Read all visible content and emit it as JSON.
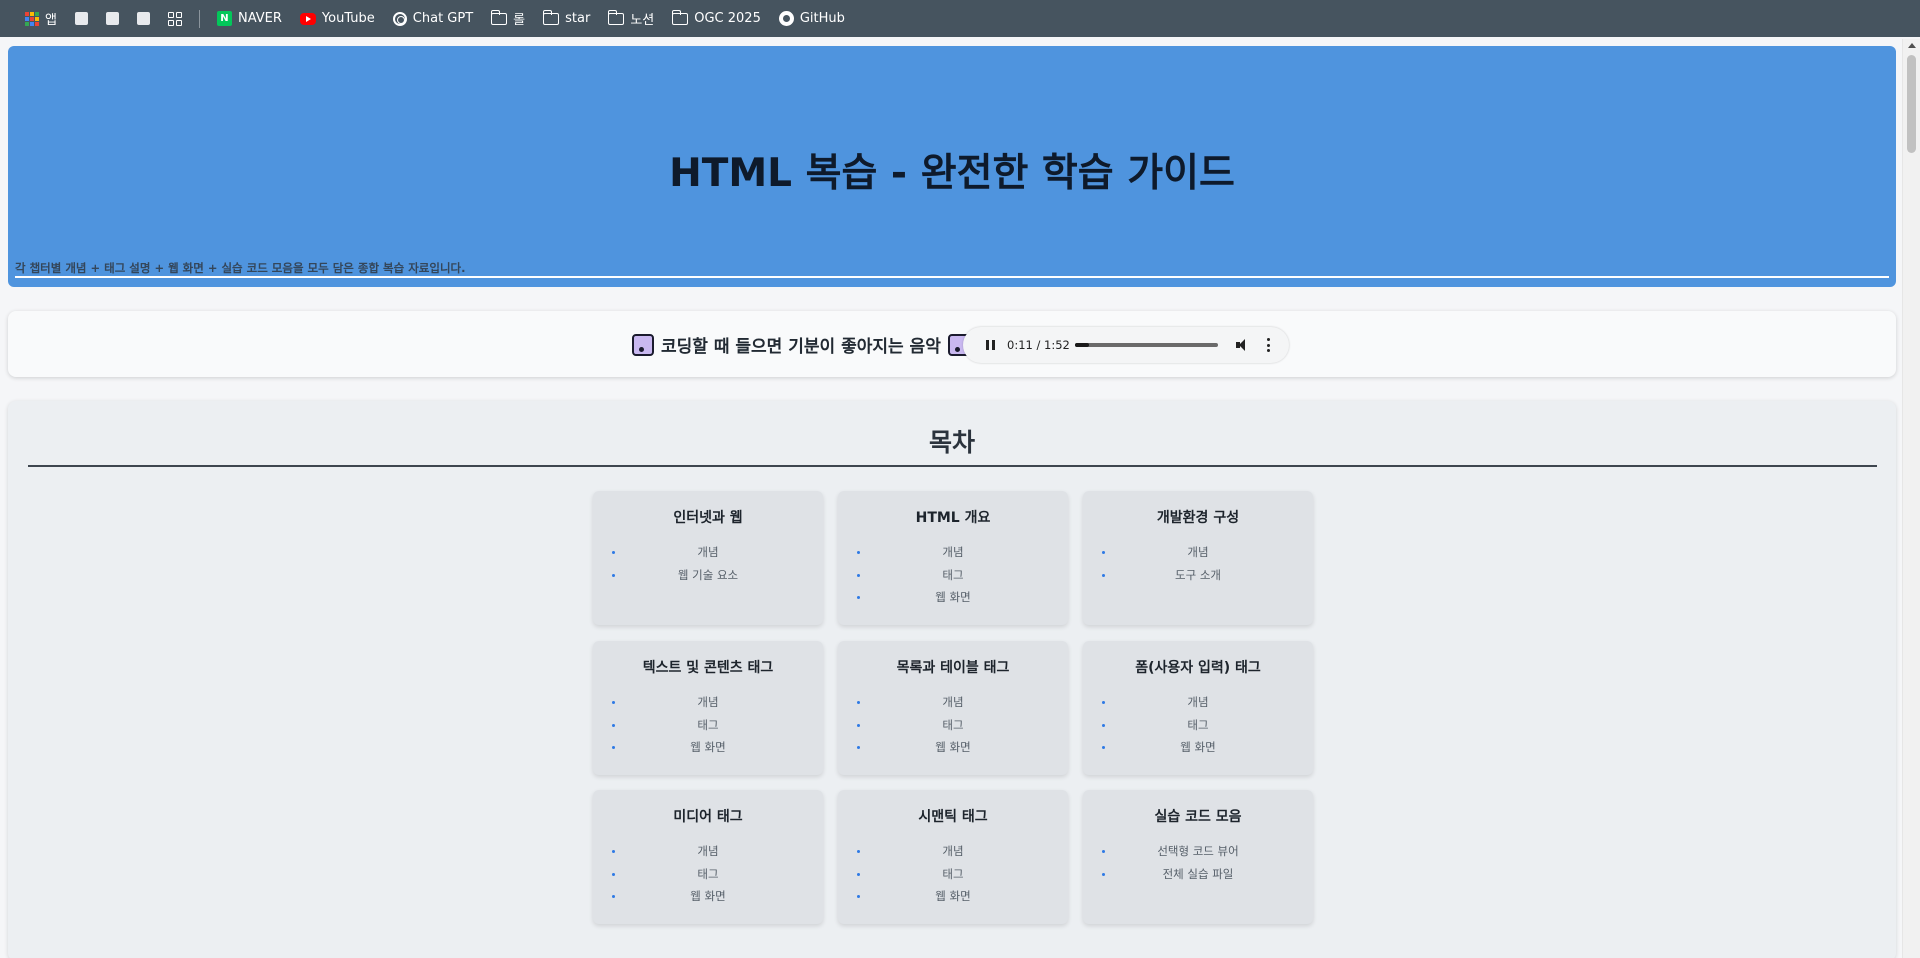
{
  "bookmarks": {
    "apps_label": "앱",
    "items": [
      {
        "label": "NAVER",
        "icon": "naver-icon"
      },
      {
        "label": "YouTube",
        "icon": "youtube-icon"
      },
      {
        "label": "Chat GPT",
        "icon": "chatgpt-icon"
      },
      {
        "label": "롤",
        "icon": "folder-icon"
      },
      {
        "label": "star",
        "icon": "folder-icon"
      },
      {
        "label": "노션",
        "icon": "folder-icon"
      },
      {
        "label": "OGC 2025",
        "icon": "folder-icon"
      },
      {
        "label": "GitHub",
        "icon": "github-icon"
      }
    ]
  },
  "hero": {
    "title": "HTML 복습 - 완전한 학습 가이드",
    "subtitle": "각 챕터별 개념 + 태그 설명 + 웹 화면 + 실습 코드 모음을 모두 담은 종합 복습 자료입니다.",
    "background_color": "#4f94de"
  },
  "music": {
    "title": "코딩할 때 들으면 기분이 좋아지는 음악",
    "player_time": "0:11 / 1:52",
    "progress_fraction": 0.1,
    "state": "playing"
  },
  "toc": {
    "title": "목차",
    "cards": [
      {
        "title": "인터넷과 웹",
        "items": [
          "개념",
          "웹 기술 요소"
        ]
      },
      {
        "title": "HTML 개요",
        "items": [
          "개념",
          "태그",
          "웹 화면"
        ]
      },
      {
        "title": "개발환경 구성",
        "items": [
          "개념",
          "도구 소개"
        ]
      },
      {
        "title": "텍스트 및 콘텐츠 태그",
        "items": [
          "개념",
          "태그",
          "웹 화면"
        ]
      },
      {
        "title": "목록과 테이블 태그",
        "items": [
          "개념",
          "태그",
          "웹 화면"
        ]
      },
      {
        "title": "폼(사용자 입력) 태그",
        "items": [
          "개념",
          "태그",
          "웹 화면"
        ]
      },
      {
        "title": "미디어 태그",
        "items": [
          "개념",
          "태그",
          "웹 화면"
        ]
      },
      {
        "title": "시맨틱 태그",
        "items": [
          "개념",
          "태그",
          "웹 화면"
        ]
      },
      {
        "title": "실습 코드 모음",
        "items": [
          "선택형 코드 뷰어",
          "전체 실습 파일"
        ]
      }
    ]
  }
}
